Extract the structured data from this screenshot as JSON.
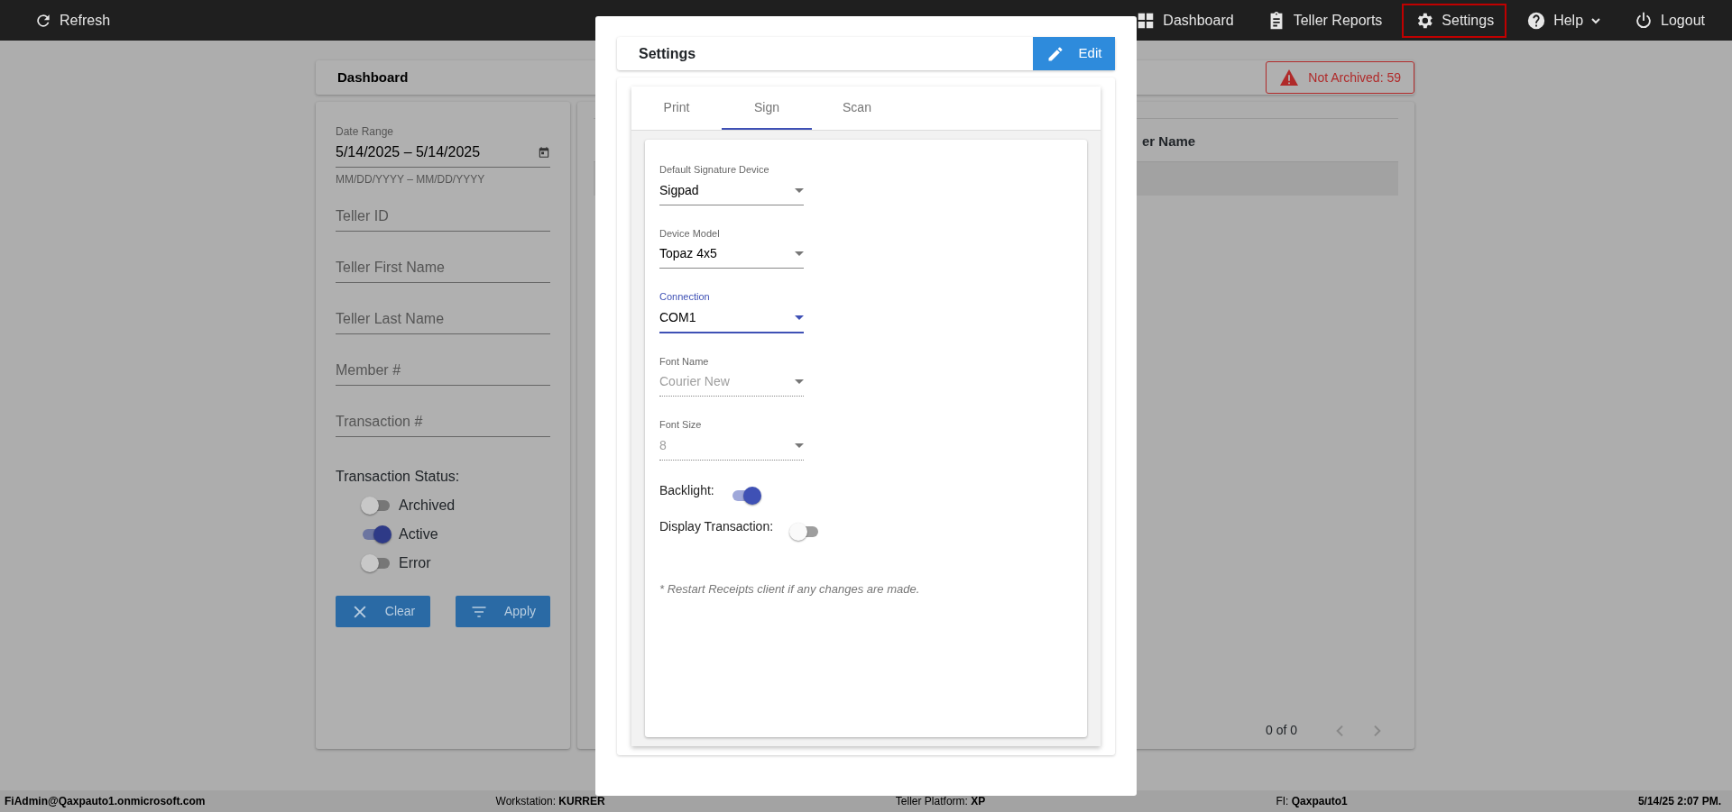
{
  "topbar": {
    "refresh": "Refresh",
    "nav": [
      {
        "label": "Dashboard",
        "selected": false
      },
      {
        "label": "Teller Reports",
        "selected": false
      },
      {
        "label": "Settings",
        "selected": true
      },
      {
        "label": "Help",
        "selected": false,
        "dropdown": true
      },
      {
        "label": "Logout",
        "selected": false
      }
    ]
  },
  "dashboard": {
    "title": "Dashboard",
    "alert": "Not Archived: 59"
  },
  "filters": {
    "date_range": {
      "label": "Date Range",
      "value": "5/14/2025 – 5/14/2025",
      "hint": "MM/DD/YYYY – MM/DD/YYYY"
    },
    "fields": [
      {
        "placeholder": "Teller ID"
      },
      {
        "placeholder": "Teller First Name"
      },
      {
        "placeholder": "Teller Last Name"
      },
      {
        "placeholder": "Member #"
      },
      {
        "placeholder": "Transaction #"
      }
    ],
    "status_label": "Transaction Status:",
    "statuses": [
      {
        "label": "Archived",
        "on": false
      },
      {
        "label": "Active",
        "on": true
      },
      {
        "label": "Error",
        "on": false
      }
    ],
    "buttons": [
      "Clear",
      "Apply"
    ]
  },
  "table": {
    "columns": [
      "er Name"
    ],
    "pagination": "0 of 0"
  },
  "settings_dialog": {
    "title": "Settings",
    "edit_button": "Edit",
    "tabs": [
      {
        "label": "Print",
        "selected": false
      },
      {
        "label": "Sign",
        "selected": true
      },
      {
        "label": "Scan",
        "selected": false
      }
    ],
    "selects": [
      {
        "label": "Default Signature Device",
        "value": "Sigpad",
        "focused": false,
        "disabled": false
      },
      {
        "label": "Device Model",
        "value": "Topaz 4x5",
        "focused": false,
        "disabled": false
      },
      {
        "label": "Connection",
        "value": "COM1",
        "focused": true,
        "disabled": false
      },
      {
        "label": "Font Name",
        "value": "Courier New",
        "focused": false,
        "disabled": true
      },
      {
        "label": "Font Size",
        "value": "8",
        "focused": false,
        "disabled": true
      }
    ],
    "toggles": [
      {
        "label": "Backlight:",
        "on": true
      },
      {
        "label": "Display Transaction:",
        "on": false
      }
    ],
    "note": "* Restart Receipts client if any changes are made."
  },
  "status_bar": [
    {
      "text": "FiAdmin@Qaxpauto1.onmicrosoft.com",
      "bold": true
    },
    {
      "text": "Workstation: **KURRER**",
      "bold": false
    },
    {
      "text": "Teller Platform: **XP**",
      "bold": false
    },
    {
      "text": "FI: **Qaxpauto1**",
      "bold": false
    },
    {
      "text": "5/14/25 2:07 PM.",
      "bold": true
    }
  ]
}
